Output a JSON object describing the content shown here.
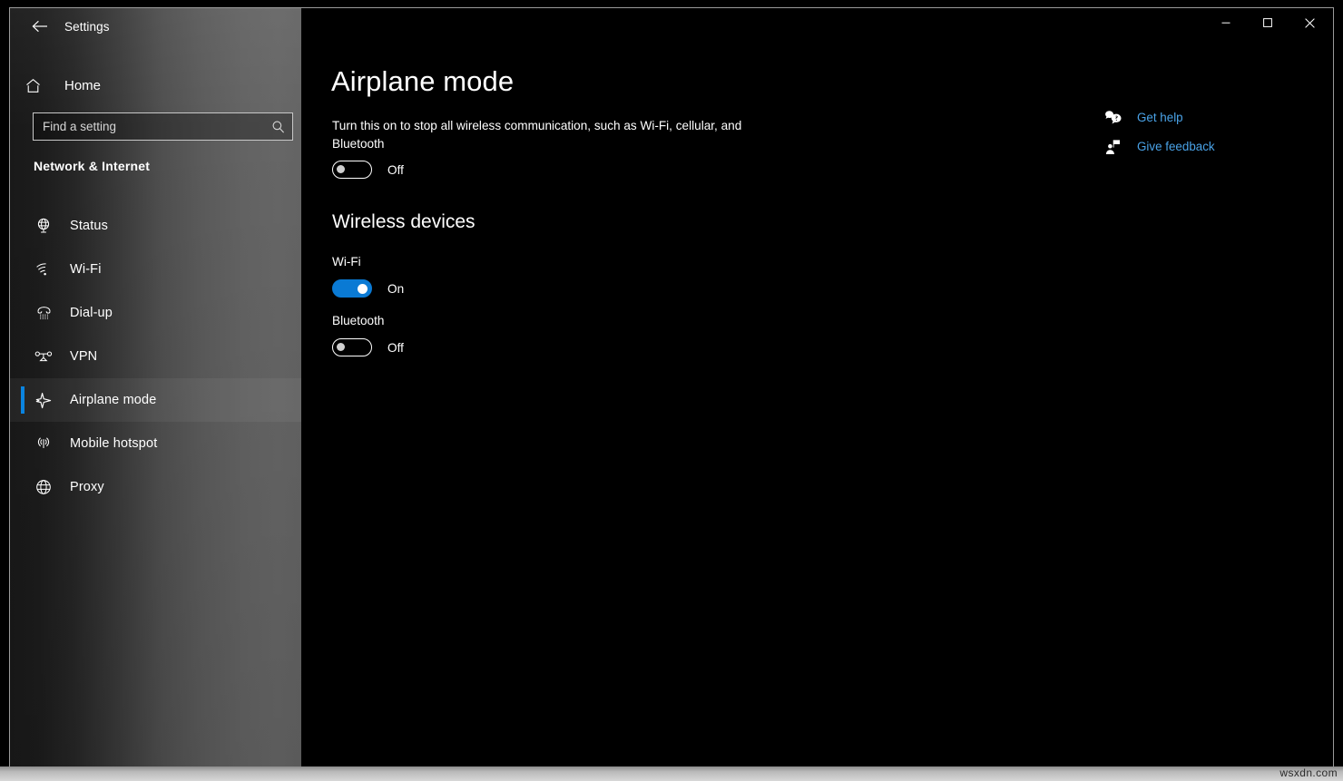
{
  "window": {
    "title": "Settings",
    "back_icon": "back-arrow-icon",
    "minimize_label": "—",
    "maximize_label": "□",
    "close_label": "✕"
  },
  "sidebar": {
    "home": {
      "label": "Home",
      "icon": "home-icon"
    },
    "search": {
      "placeholder": "Find a setting",
      "value": "",
      "icon": "search-icon"
    },
    "category": "Network & Internet",
    "items": [
      {
        "label": "Status",
        "icon": "status-globe-icon",
        "selected": false
      },
      {
        "label": "Wi-Fi",
        "icon": "wifi-icon",
        "selected": false
      },
      {
        "label": "Dial-up",
        "icon": "dialup-phone-icon",
        "selected": false
      },
      {
        "label": "VPN",
        "icon": "vpn-icon",
        "selected": false
      },
      {
        "label": "Airplane mode",
        "icon": "airplane-icon",
        "selected": true
      },
      {
        "label": "Mobile hotspot",
        "icon": "hotspot-icon",
        "selected": false
      },
      {
        "label": "Proxy",
        "icon": "proxy-globe-icon",
        "selected": false
      }
    ]
  },
  "main": {
    "title": "Airplane mode",
    "description": "Turn this on to stop all wireless communication, such as Wi-Fi, cellular, and Bluetooth",
    "airplane_toggle": {
      "state": "off",
      "label": "Off"
    },
    "section_title": "Wireless devices",
    "devices": [
      {
        "name": "Wi-Fi",
        "state": "on",
        "label": "On"
      },
      {
        "name": "Bluetooth",
        "state": "off",
        "label": "Off"
      }
    ]
  },
  "help": {
    "links": [
      {
        "label": "Get help",
        "icon": "question-bubble-icon"
      },
      {
        "label": "Give feedback",
        "icon": "feedback-person-icon"
      }
    ]
  },
  "watermark": {
    "text": "wsxdn.com"
  },
  "colors": {
    "accent": "#0a7ad4",
    "selection_bar": "#0a84e0",
    "link": "#4aa3e8",
    "content_bg": "#000000"
  }
}
